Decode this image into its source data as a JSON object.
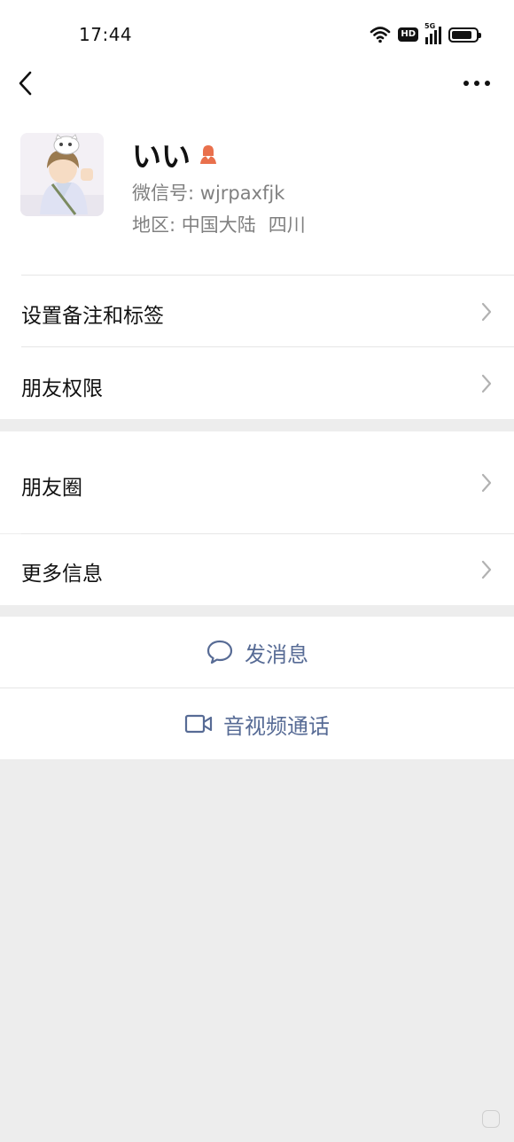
{
  "status_bar": {
    "time": "17:44",
    "wifi_icon": "wifi-icon",
    "hd_badge": "HD",
    "network_label": "5G",
    "battery_level": 0.85
  },
  "nav": {
    "back_icon": "chevron-left-icon",
    "more_icon": "more-horizontal-icon"
  },
  "profile": {
    "name": "いい",
    "gender_icon": "female-user-icon",
    "wechat_id_label": "微信号:",
    "wechat_id": "wjrpaxfjk",
    "region_label": "地区:",
    "region_country": "中国大陆",
    "region_province": "四川"
  },
  "menu": {
    "remark_tags": "设置备注和标签",
    "permissions": "朋友权限",
    "moments": "朋友圈",
    "more_info": "更多信息"
  },
  "actions": {
    "message": "发消息",
    "video_call": "音视频通话"
  },
  "colors": {
    "link_blue": "#576b95",
    "page_bg": "#ededed",
    "gender_badge": "#e9704c"
  }
}
